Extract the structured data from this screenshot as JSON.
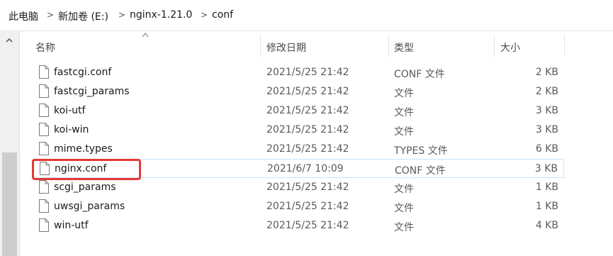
{
  "breadcrumb": {
    "items": [
      "此电脑",
      "新加卷 (E:)",
      "nginx-1.21.0",
      "conf"
    ]
  },
  "columns": {
    "name": "名称",
    "date": "修改日期",
    "type": "类型",
    "size": "大小"
  },
  "files": [
    {
      "name": "fastcgi.conf",
      "date": "2021/5/25 21:42",
      "type": "CONF 文件",
      "size": "2 KB"
    },
    {
      "name": "fastcgi_params",
      "date": "2021/5/25 21:42",
      "type": "文件",
      "size": "2 KB"
    },
    {
      "name": "koi-utf",
      "date": "2021/5/25 21:42",
      "type": "文件",
      "size": "3 KB"
    },
    {
      "name": "koi-win",
      "date": "2021/5/25 21:42",
      "type": "文件",
      "size": "3 KB"
    },
    {
      "name": "mime.types",
      "date": "2021/5/25 21:42",
      "type": "TYPES 文件",
      "size": "6 KB"
    },
    {
      "name": "nginx.conf",
      "date": "2021/6/7 10:09",
      "type": "CONF 文件",
      "size": "3 KB"
    },
    {
      "name": "scgi_params",
      "date": "2021/5/25 21:42",
      "type": "文件",
      "size": "1 KB"
    },
    {
      "name": "uwsgi_params",
      "date": "2021/5/25 21:42",
      "type": "文件",
      "size": "1 KB"
    },
    {
      "name": "win-utf",
      "date": "2021/5/25 21:42",
      "type": "文件",
      "size": "4 KB"
    }
  ],
  "icons": {
    "file": "file-icon",
    "chevron": "chevron-right-icon",
    "sort": "sort-up-icon",
    "scroll_up": "scroll-up-icon"
  },
  "colors": {
    "highlight": "#e53935",
    "selection_border": "#cce4f7"
  }
}
